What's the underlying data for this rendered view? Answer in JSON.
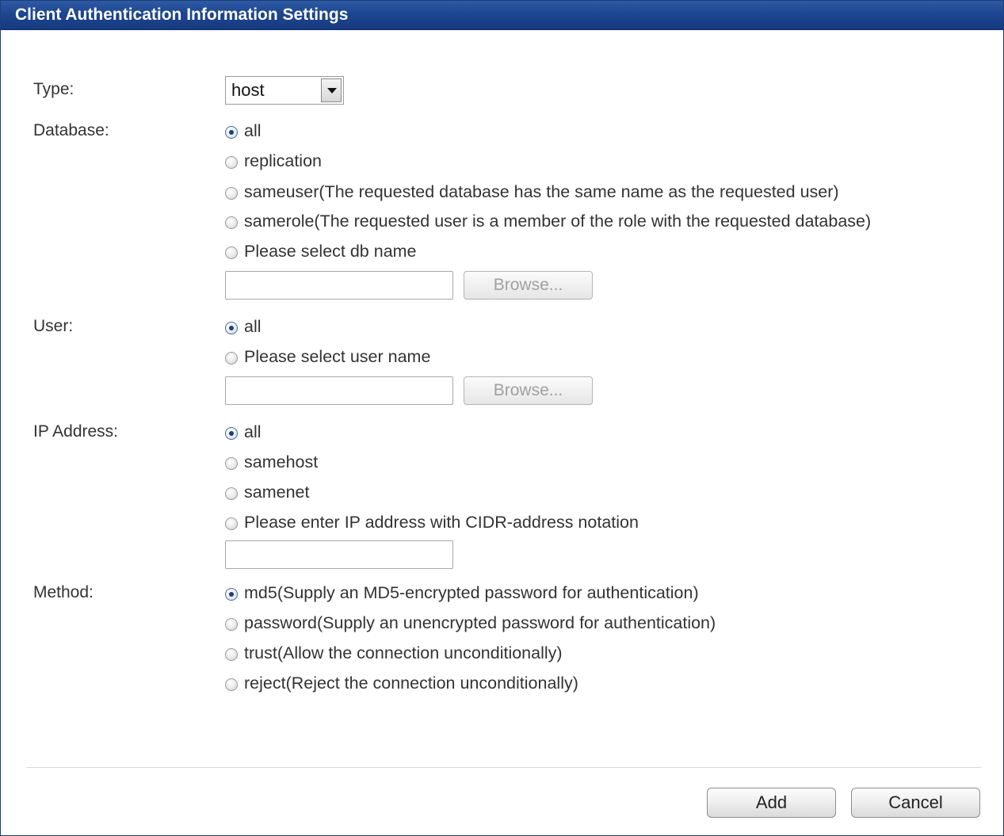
{
  "dialog": {
    "title": "Client Authentication Information Settings"
  },
  "type": {
    "label": "Type:",
    "selected": "host"
  },
  "database": {
    "label": "Database:",
    "options": [
      "all",
      "replication",
      "sameuser(The requested database has the same name as the requested user)",
      "samerole(The requested user is a member of the role with the requested database)",
      "Please select db name"
    ],
    "selected_index": 0,
    "db_name_value": "",
    "browse_label": "Browse..."
  },
  "user": {
    "label": "User:",
    "options": [
      "all",
      "Please select user name"
    ],
    "selected_index": 0,
    "user_name_value": "",
    "browse_label": "Browse..."
  },
  "ip_address": {
    "label": "IP Address:",
    "options": [
      "all",
      "samehost",
      "samenet",
      "Please enter IP address with CIDR-address notation"
    ],
    "selected_index": 0,
    "cidr_value": ""
  },
  "method": {
    "label": "Method:",
    "options": [
      "md5(Supply an MD5-encrypted password for authentication)",
      "password(Supply an unencrypted password for authentication)",
      "trust(Allow the connection unconditionally)",
      "reject(Reject the connection unconditionally)"
    ],
    "selected_index": 0
  },
  "footer": {
    "add_label": "Add",
    "cancel_label": "Cancel"
  }
}
